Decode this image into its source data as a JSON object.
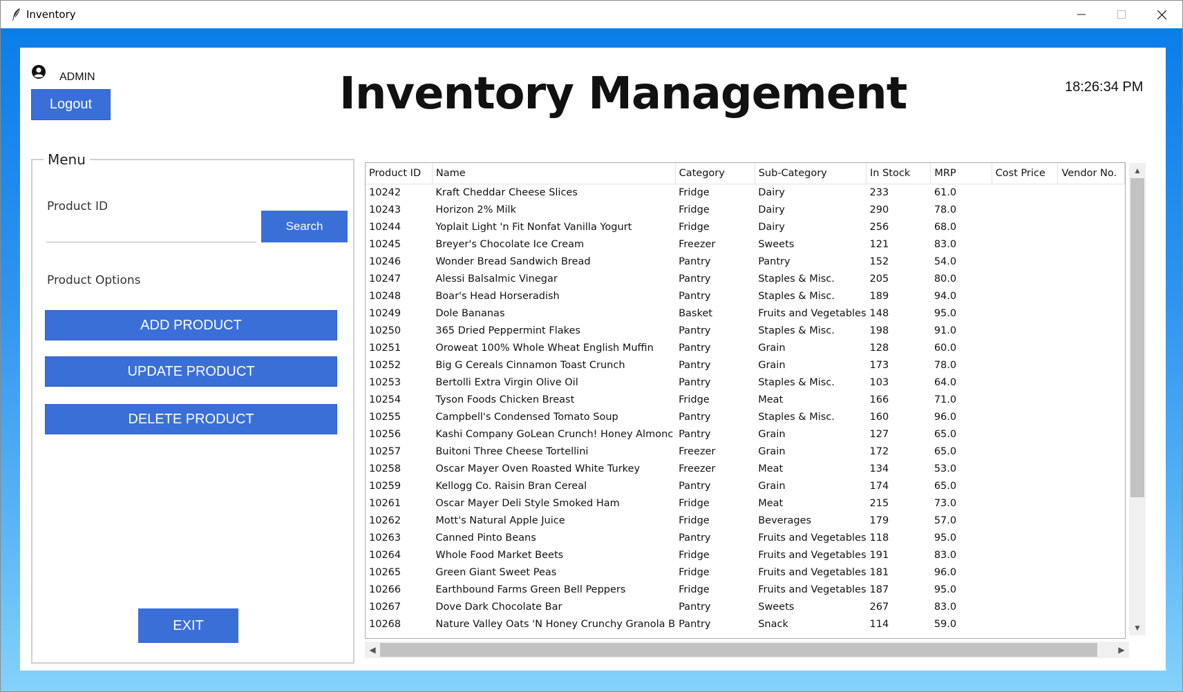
{
  "window": {
    "title": "Inventory"
  },
  "user": {
    "name": "ADMIN",
    "logout_label": "Logout"
  },
  "header": {
    "title": "Inventory Management",
    "clock": "18:26:34 PM"
  },
  "menu": {
    "legend": "Menu",
    "product_id_label": "Product ID",
    "product_id_value": "",
    "search_label": "Search",
    "options_label": "Product Options",
    "add_label": "ADD PRODUCT",
    "update_label": "UPDATE PRODUCT",
    "delete_label": "DELETE PRODUCT",
    "exit_label": "EXIT"
  },
  "table": {
    "columns": [
      "Product ID",
      "Name",
      "Category",
      "Sub-Category",
      "In Stock",
      "MRP",
      "Cost Price",
      "Vendor No."
    ],
    "rows": [
      [
        "10242",
        "Kraft Cheddar Cheese Slices",
        "Fridge",
        "Dairy",
        "233",
        "61.0",
        "",
        ""
      ],
      [
        "10243",
        "Horizon 2% Milk",
        "Fridge",
        "Dairy",
        "290",
        "78.0",
        "",
        ""
      ],
      [
        "10244",
        "Yoplait Light 'n Fit Nonfat Vanilla Yogurt",
        "Fridge",
        "Dairy",
        "256",
        "68.0",
        "",
        ""
      ],
      [
        "10245",
        "Breyer's Chocolate Ice Cream",
        "Freezer",
        "Sweets",
        "121",
        "83.0",
        "",
        ""
      ],
      [
        "10246",
        "Wonder Bread Sandwich Bread",
        "Pantry",
        "Pantry",
        "152",
        "54.0",
        "",
        ""
      ],
      [
        "10247",
        "Alessi Balsalmic Vinegar",
        "Pantry",
        "Staples & Misc.",
        "205",
        "80.0",
        "",
        ""
      ],
      [
        "10248",
        "Boar's Head Horseradish",
        "Pantry",
        "Staples & Misc.",
        "189",
        "94.0",
        "",
        ""
      ],
      [
        "10249",
        "Dole Bananas",
        "Basket",
        "Fruits and Vegetables",
        "148",
        "95.0",
        "",
        ""
      ],
      [
        "10250",
        "365 Dried Peppermint Flakes",
        "Pantry",
        "Staples & Misc.",
        "198",
        "91.0",
        "",
        ""
      ],
      [
        "10251",
        "Oroweat 100% Whole Wheat English Muffin",
        "Pantry",
        "Grain",
        "128",
        "60.0",
        "",
        ""
      ],
      [
        "10252",
        "Big G Cereals Cinnamon Toast Crunch",
        "Pantry",
        "Grain",
        "173",
        "78.0",
        "",
        ""
      ],
      [
        "10253",
        "Bertolli Extra Virgin Olive Oil",
        "Pantry",
        "Staples & Misc.",
        "103",
        "64.0",
        "",
        ""
      ],
      [
        "10254",
        "Tyson Foods Chicken Breast",
        "Fridge",
        "Meat",
        "166",
        "71.0",
        "",
        ""
      ],
      [
        "10255",
        "Campbell's Condensed Tomato Soup",
        "Pantry",
        "Staples & Misc.",
        "160",
        "96.0",
        "",
        ""
      ],
      [
        "10256",
        "Kashi Company GoLean Crunch! Honey Almonc",
        "Pantry",
        "Grain",
        "127",
        "65.0",
        "",
        ""
      ],
      [
        "10257",
        "Buitoni Three Cheese Tortellini",
        "Freezer",
        "Grain",
        "172",
        "65.0",
        "",
        ""
      ],
      [
        "10258",
        "Oscar Mayer Oven Roasted White Turkey",
        "Freezer",
        "Meat",
        "134",
        "53.0",
        "",
        ""
      ],
      [
        "10259",
        "Kellogg Co. Raisin Bran Cereal",
        "Pantry",
        "Grain",
        "174",
        "65.0",
        "",
        ""
      ],
      [
        "10261",
        "Oscar Mayer Deli Style Smoked Ham",
        "Fridge",
        "Meat",
        "215",
        "73.0",
        "",
        ""
      ],
      [
        "10262",
        "Mott's Natural Apple Juice",
        "Fridge",
        "Beverages",
        "179",
        "57.0",
        "",
        ""
      ],
      [
        "10263",
        "Canned Pinto Beans",
        "Pantry",
        "Fruits and Vegetables",
        "118",
        "95.0",
        "",
        ""
      ],
      [
        "10264",
        "Whole Food Market Beets",
        "Fridge",
        "Fruits and Vegetables",
        "191",
        "83.0",
        "",
        ""
      ],
      [
        "10265",
        "Green Giant Sweet Peas",
        "Fridge",
        "Fruits and Vegetables",
        "181",
        "96.0",
        "",
        ""
      ],
      [
        "10266",
        "Earthbound Farms Green Bell Peppers",
        "Fridge",
        "Fruits and Vegetables",
        "187",
        "95.0",
        "",
        ""
      ],
      [
        "10267",
        "Dove Dark Chocolate Bar",
        "Pantry",
        "Sweets",
        "267",
        "83.0",
        "",
        ""
      ],
      [
        "10268",
        "Nature Valley Oats 'N Honey Crunchy Granola B",
        "Pantry",
        "Snack",
        "114",
        "59.0",
        "",
        ""
      ]
    ]
  },
  "icons": {
    "app": "feather-icon",
    "user": "user-circle-icon",
    "minimize": "minimize-icon",
    "maximize": "maximize-icon",
    "close": "close-icon"
  },
  "colors": {
    "accent": "#3a6fd8",
    "background_top": "#0a7ee8",
    "background_bottom": "#84d2fa"
  }
}
